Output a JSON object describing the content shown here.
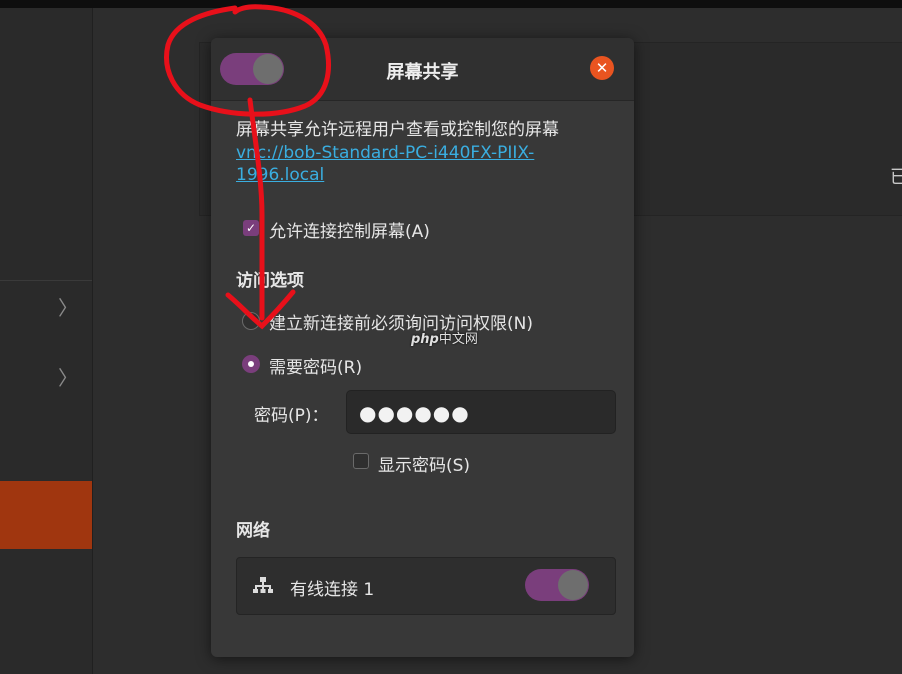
{
  "dialog": {
    "title": "屏幕共享",
    "description": "屏幕共享允许远程用户查看或控制您的屏幕",
    "address": "vnc://bob-Standard-PC-i440FX-PIIX-1996.local",
    "allow_control_label": "允许连接控制屏幕(A)",
    "access_options_heading": "访问选项",
    "ask_permission_label": "建立新连接前必须询问访问权限(N)",
    "require_password_label": "需要密码(R)",
    "password_label": "密码(P)：",
    "password_value": "●●●●●●",
    "show_password_label": "显示密码(S)",
    "network_heading": "网络",
    "network_item_label": "有线连接 1",
    "close_icon": "close-icon",
    "sharing_enabled": true,
    "allow_control": true,
    "access_mode": "require_password",
    "show_password": false,
    "network_enabled": true
  },
  "watermark": {
    "brand": "php",
    "text": "中文网"
  },
  "sidebar": {
    "chevrons": [
      "〉",
      "〉"
    ]
  },
  "main": {
    "truncated_text": "已"
  },
  "colors": {
    "accent": "#e95420",
    "toggle_on": "#7a3e7c",
    "link": "#3aaee0",
    "annotation": "#e8101a"
  }
}
